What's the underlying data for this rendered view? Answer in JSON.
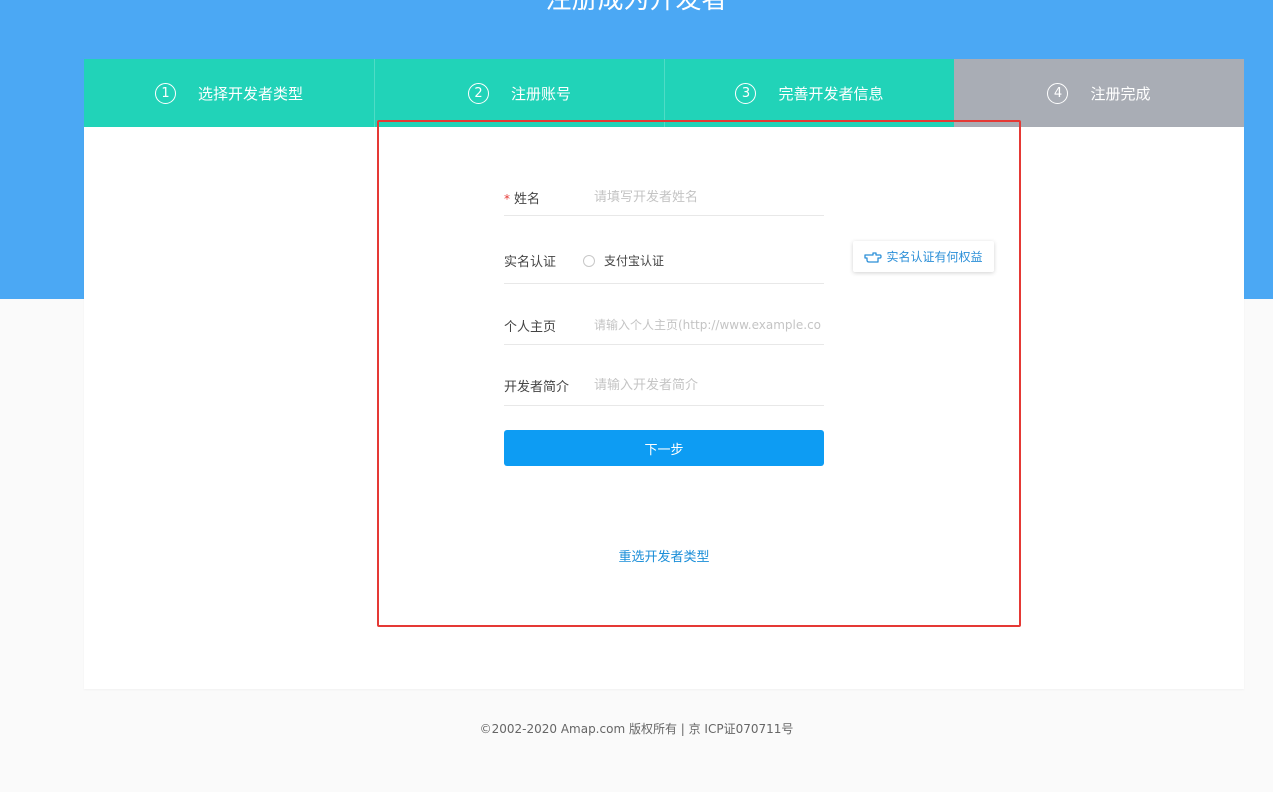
{
  "page": {
    "title": "注册成为开发者"
  },
  "steps": [
    {
      "num": "1",
      "label": "选择开发者类型",
      "state": "active"
    },
    {
      "num": "2",
      "label": "注册账号",
      "state": "active"
    },
    {
      "num": "3",
      "label": "完善开发者信息",
      "state": "active"
    },
    {
      "num": "4",
      "label": "注册完成",
      "state": "inactive"
    }
  ],
  "form": {
    "name": {
      "required_mark": "*",
      "label": "姓名",
      "placeholder": "请填写开发者姓名"
    },
    "realname": {
      "label": "实名认证",
      "option": "支付宝认证"
    },
    "homepage": {
      "label": "个人主页",
      "placeholder": "请输入个人主页(http://www.example.com)"
    },
    "intro": {
      "label": "开发者简介",
      "placeholder": "请输入开发者简介"
    },
    "next_button": "下一步",
    "reselect_link": "重选开发者类型"
  },
  "benefit_button": {
    "label": "实名认证有何权益",
    "icon": "pointing-hand-icon"
  },
  "footer": {
    "text": "©2002-2020 Amap.com 版权所有 | 京 ICP证070711号"
  },
  "colors": {
    "hero": "#4ba8f4",
    "step_active": "#21d3b8",
    "step_inactive": "#a9adb5",
    "primary": "#0d9cf3",
    "highlight": "#e53935"
  }
}
